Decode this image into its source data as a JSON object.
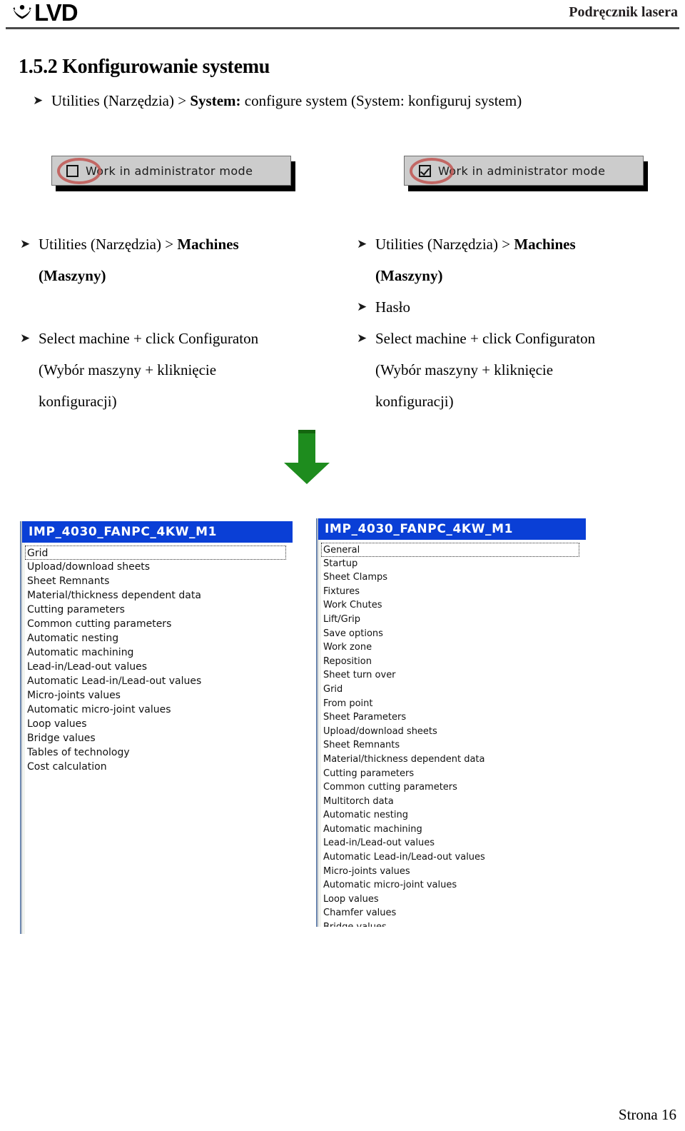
{
  "header": {
    "logo_text": "LVD",
    "logo_mark_icon": "lvd-emblem-icon",
    "manual_title": "Podręcznik lasera"
  },
  "section": {
    "heading": "1.5.2 Konfigurowanie systemu",
    "bullet_glyph": "➤",
    "intro_bullet": {
      "pre": "Utilities (Narzędzia) > ",
      "bold": "System:",
      "post": " configure system (System: konfiguruj system)"
    }
  },
  "checkbox_figures": [
    {
      "label": "Work in administrator mode",
      "checked": false,
      "annotation_icon": "red-ellipse-highlight-icon",
      "annotation_color": "#c0504d"
    },
    {
      "label": "Work in administrator mode",
      "checked": true,
      "annotation_icon": "red-ellipse-highlight-icon",
      "annotation_color": "#c0504d"
    }
  ],
  "columns": {
    "left": {
      "b1_pre": "Utilities (Narzędzia) > ",
      "b1_bold": "Machines",
      "b1_cont": "(Maszyny)",
      "b2": "Select machine + click Configuraton",
      "b2_cont1": "(Wybór maszyny + kliknięcie",
      "b2_cont2": "konfiguracji)"
    },
    "right": {
      "b1_pre": "Utilities (Narzędzia) > ",
      "b1_bold": "Machines",
      "b1_cont": "(Maszyny)",
      "b_haslo": "Hasło",
      "b2": "Select machine + click Configuraton",
      "b2_cont1": "(Wybór maszyny + kliknięcie",
      "b2_cont2": "konfiguracji)"
    }
  },
  "arrow": {
    "icon": "green-down-arrow-icon",
    "color": "#1e8c1e"
  },
  "tree_left": {
    "title": "IMP_4030_FANPC_4KW_M1",
    "selected_index": 0,
    "items": [
      "Grid",
      "Upload/download sheets",
      "Sheet Remnants",
      "Material/thickness dependent data",
      "Cutting parameters",
      "Common cutting parameters",
      "Automatic nesting",
      "Automatic machining",
      "Lead-in/Lead-out values",
      "Automatic Lead-in/Lead-out values",
      "Micro-joints values",
      "Automatic micro-joint values",
      "Loop values",
      "Bridge values",
      "Tables of technology",
      "Cost calculation"
    ]
  },
  "tree_right": {
    "title": "IMP_4030_FANPC_4KW_M1",
    "selected_index": 0,
    "items": [
      "General",
      "Startup",
      "Sheet Clamps",
      "Fixtures",
      "Work Chutes",
      "Lift/Grip",
      "Save options",
      "Work zone",
      "Reposition",
      "Sheet turn over",
      "Grid",
      "From point",
      "Sheet Parameters",
      "Upload/download sheets",
      "Sheet Remnants",
      "Material/thickness dependent data",
      "Cutting parameters",
      "Common cutting parameters",
      "Multitorch data",
      "Automatic nesting",
      "Automatic machining",
      "Lead-in/Lead-out values",
      "Automatic Lead-in/Lead-out values",
      "Micro-joints values",
      "Automatic micro-joint values",
      "Loop values",
      "Chamfer values",
      "Bridge values"
    ]
  },
  "footer": {
    "page_label": "Strona 16"
  }
}
